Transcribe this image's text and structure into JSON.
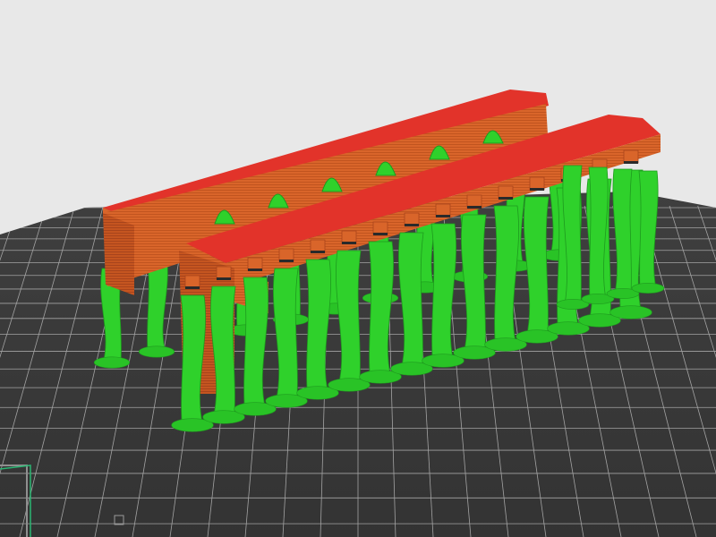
{
  "app": {
    "view": "slice-preview"
  },
  "bed": {
    "surface_color": "#3a3a3a",
    "grid_color": "#a3a3a3",
    "edge_accent_color": "#2bb673",
    "edge_label_left": "",
    "edge_label_bottom": ""
  },
  "model": {
    "part_color": "#d9652a",
    "part_shadow_color": "#a8441c",
    "top_layer_color": "#e2332a",
    "support_color": "#2fd12b",
    "support_dark_color": "#1e9a1e",
    "support_base_color": "#29c326"
  }
}
